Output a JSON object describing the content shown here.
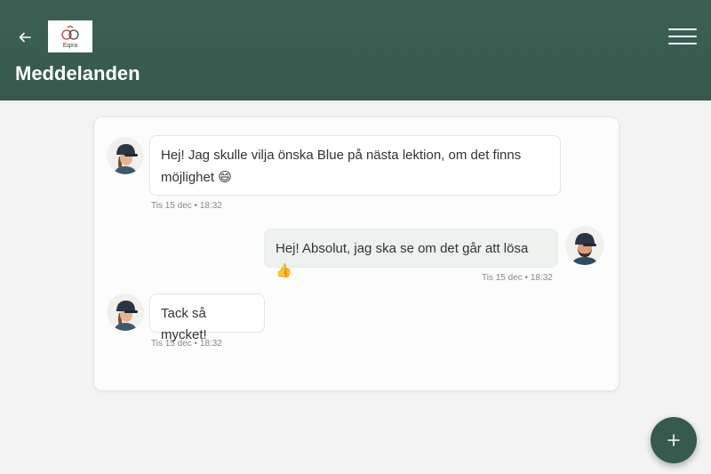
{
  "header": {
    "logo_text": "Eqira",
    "title": "Meddelanden"
  },
  "icons": {
    "back": "back-arrow-icon",
    "menu": "hamburger-menu-icon",
    "add": "plus-icon"
  },
  "colors": {
    "header_bg": "#365a4d",
    "fab_bg": "#365a4d",
    "outgoing_bubble": "#eef2ef"
  },
  "messages": [
    {
      "direction": "incoming",
      "text": "Hej! Jag skulle vilja önska Blue på nästa lektion, om det finns möjlighet",
      "emoji": "😄",
      "time": "Tis 15 dec • 18:32"
    },
    {
      "direction": "outgoing",
      "text": "Hej! Absolut, jag ska se om det går att lösa",
      "emoji": "👍",
      "time": "Tis 15 dec • 18:32"
    },
    {
      "direction": "incoming",
      "text": "Tack så mycket!",
      "emoji": "",
      "time": "Tis 15 dec • 18:32"
    }
  ]
}
